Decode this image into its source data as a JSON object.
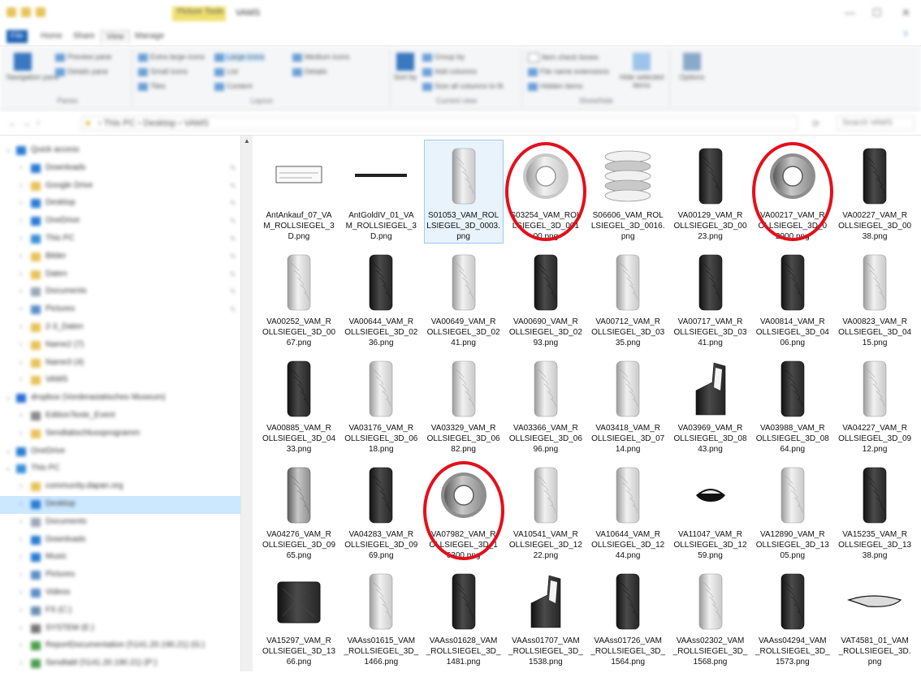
{
  "window": {
    "title": "VAMS",
    "context_tab": "Picture Tools",
    "controls": [
      "—",
      "☐",
      "✕"
    ]
  },
  "ribbon_tabs": [
    "File",
    "Home",
    "Share",
    "View",
    "Manage"
  ],
  "ribbon": {
    "panes": {
      "nav_pane": "Navigation pane",
      "preview": "Preview pane",
      "details": "Details pane",
      "label": "Panes"
    },
    "layout": {
      "items": [
        "Extra large icons",
        "Large icons",
        "Medium icons",
        "Small icons",
        "List",
        "Details",
        "Tiles",
        "Content"
      ],
      "label": "Layout"
    },
    "current_view": {
      "items": [
        "Group by",
        "Add columns",
        "Size all columns to fit",
        "Sort by"
      ],
      "label": "Current view"
    },
    "show_hide": {
      "items": [
        "Item check boxes",
        "File name extensions",
        "Hidden items",
        "Hide selected items"
      ],
      "label": "Show/hide"
    },
    "options": "Options"
  },
  "address": {
    "path": "› This PC › Desktop › VAMS",
    "search_placeholder": "Search VAMS"
  },
  "sidebar": [
    {
      "label": "Quick access",
      "icon": "star-icon",
      "color": "#2b7cd3",
      "indent": 0,
      "pinned": false
    },
    {
      "label": "Downloads",
      "icon": "download-icon",
      "color": "#2b7cd3",
      "indent": 1,
      "pinned": true
    },
    {
      "label": "Google Drive",
      "icon": "folder-icon",
      "color": "#e8c35a",
      "indent": 1,
      "pinned": true
    },
    {
      "label": "Desktop",
      "icon": "desktop-icon",
      "color": "#2b7cd3",
      "indent": 1,
      "pinned": true
    },
    {
      "label": "OneDrive",
      "icon": "cloud-icon",
      "color": "#2b7cd3",
      "indent": 1,
      "pinned": true
    },
    {
      "label": "This PC",
      "icon": "pc-icon",
      "color": "#3a8fd8",
      "indent": 1,
      "pinned": true
    },
    {
      "label": "Bilder",
      "icon": "folder-icon",
      "color": "#e8c35a",
      "indent": 1,
      "pinned": true
    },
    {
      "label": "Daten",
      "icon": "folder-icon",
      "color": "#e8c35a",
      "indent": 1,
      "pinned": true
    },
    {
      "label": "Documents",
      "icon": "document-icon",
      "color": "#9aa7b6",
      "indent": 1,
      "pinned": true
    },
    {
      "label": "Pictures",
      "icon": "picture-icon",
      "color": "#5c8fc9",
      "indent": 1,
      "pinned": true
    },
    {
      "label": "2-3_Daten",
      "icon": "folder-icon",
      "color": "#e8c35a",
      "indent": 1,
      "pinned": false
    },
    {
      "label": "Name2 (7)",
      "icon": "folder-icon",
      "color": "#e8c35a",
      "indent": 1,
      "pinned": false
    },
    {
      "label": "Name3 (4)",
      "icon": "folder-icon",
      "color": "#e8c35a",
      "indent": 1,
      "pinned": false
    },
    {
      "label": "VAMS",
      "icon": "folder-icon",
      "color": "#e8c35a",
      "indent": 1,
      "pinned": false
    },
    {
      "label": "dropbox (Vorderasiatisches Museum)",
      "icon": "dropbox-icon",
      "color": "#2b6fd6",
      "indent": 0,
      "pinned": false
    },
    {
      "label": "EditionTexte_Event",
      "icon": "folder-icon",
      "color": "#8a8a8a",
      "indent": 1,
      "pinned": false
    },
    {
      "label": "Sendtabschlussprogramm",
      "icon": "folder-icon",
      "color": "#e8c35a",
      "indent": 1,
      "pinned": false
    },
    {
      "label": "OneDrive",
      "icon": "cloud-icon",
      "color": "#2b7cd3",
      "indent": 0,
      "pinned": false
    },
    {
      "label": "This PC",
      "icon": "pc-icon",
      "color": "#3a8fd8",
      "indent": 0,
      "pinned": false
    },
    {
      "label": "community.dapan.org",
      "icon": "folder-icon",
      "color": "#e8c35a",
      "indent": 1,
      "pinned": false
    },
    {
      "label": "Desktop",
      "icon": "desktop-icon",
      "color": "#2b7cd3",
      "indent": 1,
      "pinned": false,
      "selected": true
    },
    {
      "label": "Documents",
      "icon": "document-icon",
      "color": "#9aa7b6",
      "indent": 1,
      "pinned": false
    },
    {
      "label": "Downloads",
      "icon": "download-icon",
      "color": "#2b7cd3",
      "indent": 1,
      "pinned": false
    },
    {
      "label": "Music",
      "icon": "music-icon",
      "color": "#2b7cd3",
      "indent": 1,
      "pinned": false
    },
    {
      "label": "Pictures",
      "icon": "picture-icon",
      "color": "#5c8fc9",
      "indent": 1,
      "pinned": false
    },
    {
      "label": "Videos",
      "icon": "video-icon",
      "color": "#5c8fc9",
      "indent": 1,
      "pinned": false
    },
    {
      "label": "FS (C:)",
      "icon": "drive-icon",
      "color": "#6b8fb3",
      "indent": 1,
      "pinned": false
    },
    {
      "label": "SYSTEM (E:)",
      "icon": "drive-icon",
      "color": "#777777",
      "indent": 1,
      "pinned": false
    },
    {
      "label": "ReportDocumentation (\\\\141.20.190.21) (G:)",
      "icon": "network-drive-icon",
      "color": "#4d9e4d",
      "indent": 1,
      "pinned": false
    },
    {
      "label": "Sendtabl (\\\\141.20.190.21) (P:)",
      "icon": "network-drive-icon",
      "color": "#4d9e4d",
      "indent": 1,
      "pinned": false
    }
  ],
  "files": [
    {
      "name": "AntAnkauf_07_VAM_ROLLSIEGEL_3D.png",
      "lines": [
        "AntAnkauf_07_VA",
        "M_ROLLSIEGEL_3",
        "D.png"
      ],
      "kind": "flat",
      "tone": "line",
      "circled": false
    },
    {
      "name": "AntGoldIV_01_VAM_ROLLSIEGEL_3D.png",
      "lines": [
        "AntGoldIV_01_VA",
        "M_ROLLSIEGEL_3",
        "D.png"
      ],
      "kind": "rod",
      "tone": "dark",
      "circled": false
    },
    {
      "name": "S01053_VAM_ROLLSIEGEL_3D_0003.png",
      "lines": [
        "S01053_VAM_ROL",
        "LSIEGEL_3D_0003.",
        "png"
      ],
      "kind": "cyl",
      "tone": "light",
      "circled": false,
      "selected": true
    },
    {
      "name": "S03254_VAM_ROLLSIEGEL_3D_00100.png",
      "lines": [
        "S03254_VAM_ROL",
        "LSIEGEL_3D_001",
        "00.png"
      ],
      "kind": "ring",
      "tone": "light",
      "circled": true
    },
    {
      "name": "S06606_VAM_ROLLSIEGEL_3D_0016.png",
      "lines": [
        "S06606_VAM_ROL",
        "LSIEGEL_3D_0016.",
        "png"
      ],
      "kind": "stack",
      "tone": "light",
      "circled": false
    },
    {
      "name": "VA00129_VAM_ROLLSIEGEL_3D_0023.png",
      "lines": [
        "VA00129_VAM_R",
        "OLLSIEGEL_3D_00",
        "23.png"
      ],
      "kind": "cyl",
      "tone": "dark",
      "circled": false
    },
    {
      "name": "VA00217_VAM_ROLLSIEGEL_3D_02900.png",
      "lines": [
        "VA00217_VAM_R",
        "OLLSIEGEL_3D_0",
        "2900.png"
      ],
      "kind": "ring",
      "tone": "mid",
      "circled": true
    },
    {
      "name": "VA00227_VAM_ROLLSIEGEL_3D_0038.png",
      "lines": [
        "VA00227_VAM_R",
        "OLLSIEGEL_3D_00",
        "38.png"
      ],
      "kind": "cyl",
      "tone": "dark",
      "circled": false
    },
    {
      "name": "VA00252_VAM_ROLLSIEGEL_3D_0067.png",
      "lines": [
        "VA00252_VAM_R",
        "OLLSIEGEL_3D_00",
        "67.png"
      ],
      "kind": "cyl",
      "tone": "light",
      "circled": false
    },
    {
      "name": "VA00644_VAM_ROLLSIEGEL_3D_0236.png",
      "lines": [
        "VA00644_VAM_R",
        "OLLSIEGEL_3D_02",
        "36.png"
      ],
      "kind": "cyl",
      "tone": "dark",
      "circled": false
    },
    {
      "name": "VA00649_VAM_ROLLSIEGEL_3D_0241.png",
      "lines": [
        "VA00649_VAM_R",
        "OLLSIEGEL_3D_02",
        "41.png"
      ],
      "kind": "cyl",
      "tone": "light",
      "circled": false
    },
    {
      "name": "VA00690_VAM_ROLLSIEGEL_3D_0293.png",
      "lines": [
        "VA00690_VAM_R",
        "OLLSIEGEL_3D_02",
        "93.png"
      ],
      "kind": "cyl",
      "tone": "dark",
      "circled": false
    },
    {
      "name": "VA00712_VAM_ROLLSIEGEL_3D_0335.png",
      "lines": [
        "VA00712_VAM_R",
        "OLLSIEGEL_3D_03",
        "35.png"
      ],
      "kind": "cyl",
      "tone": "light",
      "circled": false
    },
    {
      "name": "VA00717_VAM_ROLLSIEGEL_3D_0341.png",
      "lines": [
        "VA00717_VAM_R",
        "OLLSIEGEL_3D_03",
        "41.png"
      ],
      "kind": "cyl",
      "tone": "dark",
      "circled": false
    },
    {
      "name": "VA00814_VAM_ROLLSIEGEL_3D_0406.png",
      "lines": [
        "VA00814_VAM_R",
        "OLLSIEGEL_3D_04",
        "06.png"
      ],
      "kind": "cyl",
      "tone": "dark",
      "circled": false
    },
    {
      "name": "VA00823_VAM_ROLLSIEGEL_3D_0415.png",
      "lines": [
        "VA00823_VAM_R",
        "OLLSIEGEL_3D_04",
        "15.png"
      ],
      "kind": "cyl",
      "tone": "light",
      "circled": false
    },
    {
      "name": "VA00885_VAM_ROLLSIEGEL_3D_0433.png",
      "lines": [
        "VA00885_VAM_R",
        "OLLSIEGEL_3D_04",
        "33.png"
      ],
      "kind": "cyl",
      "tone": "dark",
      "circled": false
    },
    {
      "name": "VA03176_VAM_ROLLSIEGEL_3D_0618.png",
      "lines": [
        "VA03176_VAM_R",
        "OLLSIEGEL_3D_06",
        "18.png"
      ],
      "kind": "cyl",
      "tone": "light",
      "circled": false
    },
    {
      "name": "VA03329_VAM_ROLLSIEGEL_3D_0682.png",
      "lines": [
        "VA03329_VAM_R",
        "OLLSIEGEL_3D_06",
        "82.png"
      ],
      "kind": "cyl",
      "tone": "light",
      "circled": false
    },
    {
      "name": "VA03366_VAM_ROLLSIEGEL_3D_0696.png",
      "lines": [
        "VA03366_VAM_R",
        "OLLSIEGEL_3D_06",
        "96.png"
      ],
      "kind": "cyl",
      "tone": "light",
      "circled": false
    },
    {
      "name": "VA03418_VAM_ROLLSIEGEL_3D_0714.png",
      "lines": [
        "VA03418_VAM_R",
        "OLLSIEGEL_3D_07",
        "14.png"
      ],
      "kind": "cyl",
      "tone": "light",
      "circled": false
    },
    {
      "name": "VA03969_VAM_ROLLSIEGEL_3D_0843.png",
      "lines": [
        "VA03969_VAM_R",
        "OLLSIEGEL_3D_08",
        "43.png"
      ],
      "kind": "frag",
      "tone": "dark",
      "circled": false
    },
    {
      "name": "VA03988_VAM_ROLLSIEGEL_3D_0864.png",
      "lines": [
        "VA03988_VAM_R",
        "OLLSIEGEL_3D_08",
        "64.png"
      ],
      "kind": "cyl",
      "tone": "dark",
      "circled": false
    },
    {
      "name": "VA04227_VAM_ROLLSIEGEL_3D_0912.png",
      "lines": [
        "VA04227_VAM_R",
        "OLLSIEGEL_3D_09",
        "12.png"
      ],
      "kind": "cyl",
      "tone": "light",
      "circled": false
    },
    {
      "name": "VA04276_VAM_ROLLSIEGEL_3D_0965.png",
      "lines": [
        "VA04276_VAM_R",
        "OLLSIEGEL_3D_09",
        "65.png"
      ],
      "kind": "cyl",
      "tone": "mid",
      "circled": false
    },
    {
      "name": "VA04283_VAM_ROLLSIEGEL_3D_0969.png",
      "lines": [
        "VA04283_VAM_R",
        "OLLSIEGEL_3D_09",
        "69.png"
      ],
      "kind": "cyl",
      "tone": "dark",
      "circled": false
    },
    {
      "name": "VA07982_VAM_ROLLSIEGEL_3D_16300.png",
      "lines": [
        "VA07982_VAM_R",
        "OLLSIEGEL_3D_1",
        "6300.png"
      ],
      "kind": "ring",
      "tone": "mid",
      "circled": true
    },
    {
      "name": "VA10541_VAM_ROLLSIEGEL_3D_1222.png",
      "lines": [
        "VA10541_VAM_R",
        "OLLSIEGEL_3D_12",
        "22.png"
      ],
      "kind": "cyl",
      "tone": "light",
      "circled": false
    },
    {
      "name": "VA10644_VAM_ROLLSIEGEL_3D_1244.png",
      "lines": [
        "VA10644_VAM_R",
        "OLLSIEGEL_3D_12",
        "44.png"
      ],
      "kind": "cyl",
      "tone": "light",
      "circled": false
    },
    {
      "name": "VA11047_VAM_ROLLSIEGEL_3D_1259.png",
      "lines": [
        "VA11047_VAM_R",
        "OLLSIEGEL_3D_12",
        "59.png"
      ],
      "kind": "chip",
      "tone": "dark",
      "circled": false
    },
    {
      "name": "VA12890_VAM_ROLLSIEGEL_3D_1305.png",
      "lines": [
        "VA12890_VAM_R",
        "OLLSIEGEL_3D_13",
        "05.png"
      ],
      "kind": "cyl",
      "tone": "light",
      "circled": false
    },
    {
      "name": "VA15235_VAM_ROLLSIEGEL_3D_1338.png",
      "lines": [
        "VA15235_VAM_R",
        "OLLSIEGEL_3D_13",
        "38.png"
      ],
      "kind": "cyl",
      "tone": "dark",
      "circled": false
    },
    {
      "name": "VA15297_VAM_ROLLSIEGEL_3D_1366.png",
      "lines": [
        "VA15297_VAM_R",
        "OLLSIEGEL_3D_13",
        "66.png"
      ],
      "kind": "block",
      "tone": "dark",
      "circled": false
    },
    {
      "name": "VAAss01615_VAM_ROLLSIEGEL_3D_1466.png",
      "lines": [
        "VAAss01615_VAM",
        "_ROLLSIEGEL_3D_",
        "1466.png"
      ],
      "kind": "cyl",
      "tone": "light",
      "circled": false
    },
    {
      "name": "VAAss01628_VAM_ROLLSIEGEL_3D_1481.png",
      "lines": [
        "VAAss01628_VAM",
        "_ROLLSIEGEL_3D_",
        "1481.png"
      ],
      "kind": "cyl",
      "tone": "dark",
      "circled": false
    },
    {
      "name": "VAAss01707_VAM_ROLLSIEGEL_3D_1538.png",
      "lines": [
        "VAAss01707_VAM",
        "_ROLLSIEGEL_3D_",
        "1538.png"
      ],
      "kind": "frag",
      "tone": "dark",
      "circled": false
    },
    {
      "name": "VAAss01726_VAM_ROLLSIEGEL_3D_1564.png",
      "lines": [
        "VAAss01726_VAM",
        "_ROLLSIEGEL_3D_",
        "1564.png"
      ],
      "kind": "cyl",
      "tone": "dark",
      "circled": false
    },
    {
      "name": "VAAss02302_VAM_ROLLSIEGEL_3D_1568.png",
      "lines": [
        "VAAss02302_VAM",
        "_ROLLSIEGEL_3D_",
        "1568.png"
      ],
      "kind": "cyl",
      "tone": "light",
      "circled": false
    },
    {
      "name": "VAAss04294_VAM_ROLLSIEGEL_3D_1573.png",
      "lines": [
        "VAAss04294_VAM",
        "_ROLLSIEGEL_3D_",
        "1573.png"
      ],
      "kind": "cyl",
      "tone": "dark",
      "circled": false
    },
    {
      "name": "VAT4581_01_VAM_ROLLSIEGEL_3D.png",
      "lines": [
        "VAT4581_01_VAM",
        "_ROLLSIEGEL_3D.",
        "png"
      ],
      "kind": "flat",
      "tone": "dark",
      "circled": false
    }
  ],
  "annotation_color": "#e3101b"
}
